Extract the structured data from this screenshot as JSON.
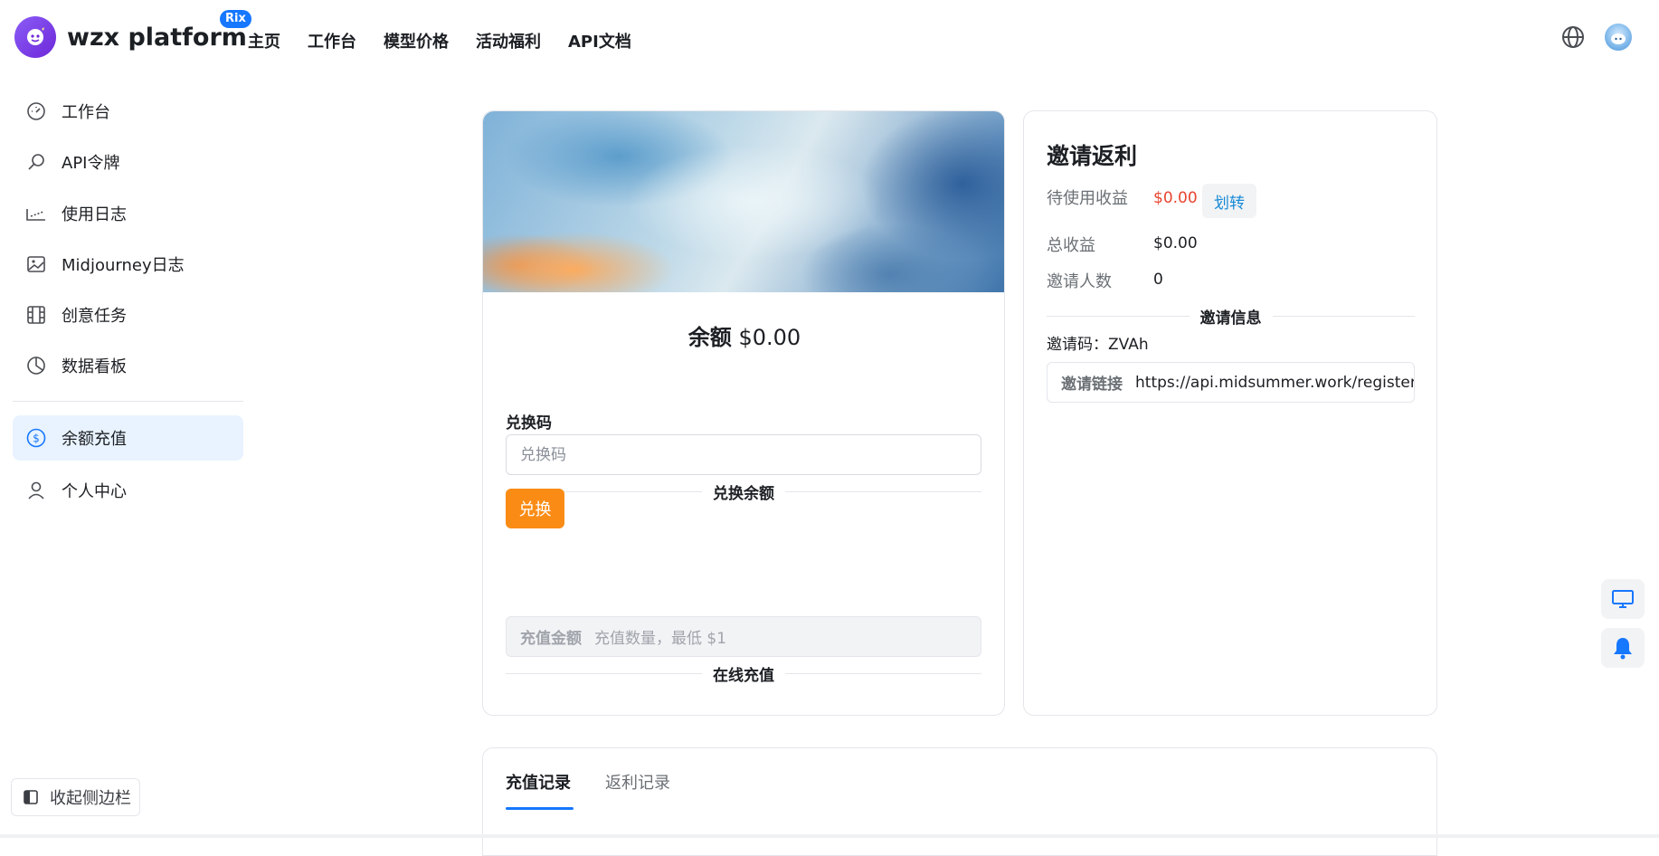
{
  "header": {
    "brand": "wzx platform",
    "badge": "Rix",
    "nav": [
      "主页",
      "工作台",
      "模型价格",
      "活动福利",
      "API文档"
    ],
    "icons": {
      "globe": "globe-icon",
      "avatar": "user-avatar"
    }
  },
  "sidebar": {
    "items": [
      {
        "label": "工作台",
        "icon": "dashboard-gauge-icon"
      },
      {
        "label": "API令牌",
        "icon": "key-icon"
      },
      {
        "label": "使用日志",
        "icon": "log-icon"
      },
      {
        "label": "Midjourney日志",
        "icon": "image-icon"
      },
      {
        "label": "创意任务",
        "icon": "film-icon"
      },
      {
        "label": "数据看板",
        "icon": "pie-chart-icon"
      },
      {
        "label": "余额充值",
        "icon": "dollar-circle-icon",
        "active": true
      },
      {
        "label": "个人中心",
        "icon": "user-icon"
      }
    ],
    "collapse_label": "收起侧边栏"
  },
  "balance": {
    "label": "余额",
    "amount": "$0.00",
    "redeem_section": "兑换余额",
    "code_label": "兑换码",
    "code_placeholder": "兑换码",
    "redeem_button": "兑换",
    "online_section": "在线充值",
    "amount_prefix": "充值金额",
    "amount_placeholder": "充值数量，最低 $1"
  },
  "invite": {
    "title": "邀请返利",
    "pending_label": "待使用收益",
    "pending_value": "$0.00",
    "transfer_button": "划转",
    "total_label": "总收益",
    "total_value": "$0.00",
    "count_label": "邀请人数",
    "count_value": "0",
    "info_section": "邀请信息",
    "code_text": "邀请码：ZVAh",
    "link_label": "邀请链接",
    "link_value": "https://api.midsummer.work/register?"
  },
  "records": {
    "tabs": [
      "充值记录",
      "返利记录"
    ],
    "active_tab": 0
  },
  "colors": {
    "accent": "#1677ff",
    "orange_button": "#fa8c16",
    "red_value": "#e8452f",
    "active_sidebar_bg": "#e8f3ff"
  }
}
